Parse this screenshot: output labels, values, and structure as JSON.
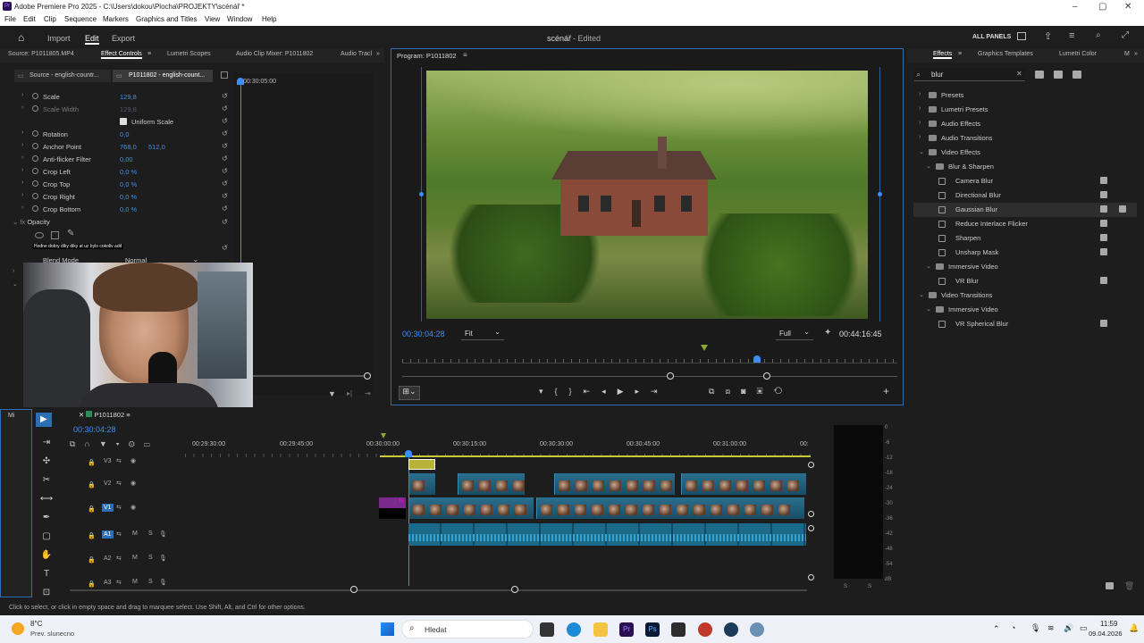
{
  "window": {
    "title": "Adobe Premiere Pro 2025 - C:\\Users\\dokou\\Plocha\\PROJEKTY\\scénář *"
  },
  "menu": [
    "File",
    "Edit",
    "Clip",
    "Sequence",
    "Markers",
    "Graphics and Titles",
    "View",
    "Window",
    "Help"
  ],
  "header": {
    "import": "Import",
    "edit": "Edit",
    "export": "Export",
    "project_title": "scénář",
    "project_status": "- Edited",
    "all_panels": "ALL PANELS"
  },
  "left_tabs": {
    "source": "Source: P1011805.MP4",
    "effect_controls": "Effect Controls",
    "lumetri": "Lumetri Scopes",
    "audio_mixer": "Audio Clip Mixer: P1011802",
    "audio_track": "Audio Tracl"
  },
  "ec_sub": {
    "source_tab": "Source - english-countr...",
    "seq_tab": "P1011802 - english-count...",
    "timecode": "00:30:05:00"
  },
  "ec_rows": [
    {
      "name": "Scale",
      "v1": "129,8",
      "v2": ""
    },
    {
      "name": "Scale Width",
      "v1": "129,8",
      "v2": ""
    },
    {
      "name": "Uniform Scale",
      "v1": "",
      "v2": ""
    },
    {
      "name": "Rotation",
      "v1": "0,0",
      "v2": ""
    },
    {
      "name": "Anchor Point",
      "v1": "768,0",
      "v2": "512,0"
    },
    {
      "name": "Anti-flicker Filter",
      "v1": "0,00",
      "v2": ""
    },
    {
      "name": "Crop Left",
      "v1": "0,0 %",
      "v2": ""
    },
    {
      "name": "Crop Top",
      "v1": "0,0 %",
      "v2": ""
    },
    {
      "name": "Crop Right",
      "v1": "0,0 %",
      "v2": ""
    },
    {
      "name": "Crop Bottom",
      "v1": "0,0 %",
      "v2": ""
    }
  ],
  "ec_opacity": {
    "label": "Opacity",
    "caption": "Hodne dobry diky diky at uz bylo cokoliv add",
    "blend_label": "Blend Mode",
    "blend_value": "Normal"
  },
  "program": {
    "title": "Program: P1011802",
    "timecode": "00:30:04:28",
    "fit": "Fit",
    "quality": "Full",
    "duration": "00:44:16:45"
  },
  "effects_panel": {
    "tabs": [
      "Effects",
      "Graphics Templates",
      "Lumetri Color",
      "M"
    ],
    "search": "blur"
  },
  "effects_tree": [
    {
      "label": "Presets",
      "level": 0,
      "type": "folder",
      "open": false
    },
    {
      "label": "Lumetri Presets",
      "level": 0,
      "type": "folder",
      "open": false
    },
    {
      "label": "Audio Effects",
      "level": 0,
      "type": "folder",
      "open": false
    },
    {
      "label": "Audio Transitions",
      "level": 0,
      "type": "folder",
      "open": false
    },
    {
      "label": "Video Effects",
      "level": 0,
      "type": "folder",
      "open": true
    },
    {
      "label": "Blur & Sharpen",
      "level": 1,
      "type": "folder",
      "open": true
    },
    {
      "label": "Camera Blur",
      "level": 2,
      "type": "effect",
      "acc": true
    },
    {
      "label": "Directional Blur",
      "level": 2,
      "type": "effect",
      "acc": true
    },
    {
      "label": "Gaussian Blur",
      "level": 2,
      "type": "effect",
      "acc": true,
      "selected": true
    },
    {
      "label": "Reduce Interlace Flicker",
      "level": 2,
      "type": "effect",
      "acc": true
    },
    {
      "label": "Sharpen",
      "level": 2,
      "type": "effect",
      "acc": true
    },
    {
      "label": "Unsharp Mask",
      "level": 2,
      "type": "effect",
      "acc": true
    },
    {
      "label": "Immersive Video",
      "level": 1,
      "type": "folder",
      "open": true
    },
    {
      "label": "VR Blur",
      "level": 2,
      "type": "effect",
      "acc": true
    },
    {
      "label": "Video Transitions",
      "level": 0,
      "type": "folder",
      "open": true
    },
    {
      "label": "Immersive Video",
      "level": 1,
      "type": "folder",
      "open": true
    },
    {
      "label": "VR Spherical Blur",
      "level": 2,
      "type": "effect",
      "acc": true
    }
  ],
  "timeline": {
    "tab": "P1011802",
    "timecode": "00:30:04:28",
    "ruler": [
      "00:29:30:00",
      "00:29:45:00",
      "00:30:00:00",
      "00:30:15:00",
      "00:30:30:00",
      "00:30:45:00",
      "00:31:00:00",
      "00:"
    ],
    "tracks": [
      "V3",
      "V2",
      "V1",
      "A1",
      "A2",
      "A3"
    ],
    "m": "M",
    "s": "S"
  },
  "meter_labels": [
    "0",
    "-6",
    "-12",
    "-18",
    "-24",
    "-30",
    "-36",
    "-42",
    "-48",
    "-54",
    "dB"
  ],
  "meter_ss": [
    "S",
    "S"
  ],
  "status_bar": "Click to select, or click in empty space and drag to marquee select. Use Shift, Alt, and Ctrl for other options.",
  "taskbar": {
    "temp": "8°C",
    "weather": "Prev. slunecno",
    "search": "Hledat",
    "time": "11:59",
    "date": "09.04.2026"
  }
}
